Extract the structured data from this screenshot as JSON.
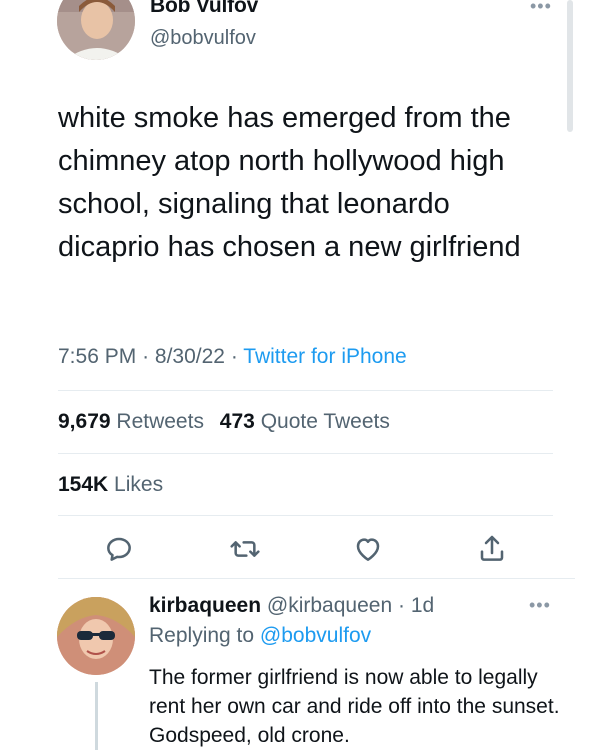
{
  "tweet": {
    "display_name": "Bob Vulfov",
    "handle": "@bobvulfov",
    "more_icon": "more-horizontal-icon",
    "text": "white smoke has emerged from the chimney atop north hollywood high school, signaling that leonardo dicaprio has chosen a new girlfriend",
    "time": "7:56 PM",
    "date": "8/30/22",
    "separator": "·",
    "source": "Twitter for iPhone",
    "retweets_count": "9,679",
    "retweets_label": "Retweets",
    "quotes_count": "473",
    "quotes_label": "Quote Tweets",
    "likes_count": "154K",
    "likes_label": "Likes",
    "actions": [
      "reply-icon",
      "retweet-icon",
      "like-icon",
      "share-icon"
    ]
  },
  "reply": {
    "display_name": "kirbaqueen",
    "handle": "@kirbaqueen",
    "separator": "·",
    "age": "1d",
    "replying_prefix": "Replying to",
    "replying_handle": "@bobvulfov",
    "text": "The former girlfriend is now able to legally rent her own car and ride off into the sunset. Godspeed, old crone."
  },
  "colors": {
    "accent": "#1d9bf0",
    "secondary_text": "#536471",
    "primary_text": "#0f1419"
  }
}
